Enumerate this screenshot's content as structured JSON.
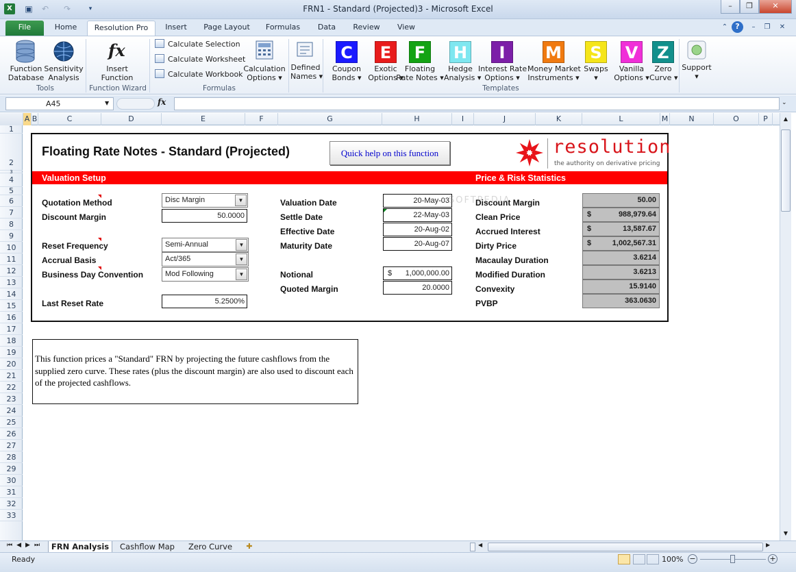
{
  "window": {
    "title": "FRN1 - Standard (Projected)3 - Microsoft Excel"
  },
  "tabs": [
    "File",
    "Home",
    "Resolution Pro",
    "Insert",
    "Page Layout",
    "Formulas",
    "Data",
    "Review",
    "View"
  ],
  "ribbon": {
    "tools": {
      "function_database": [
        "Function",
        "Database"
      ],
      "sensitivity_analysis": [
        "Sensitivity",
        "Analysis"
      ],
      "group": "Tools"
    },
    "wizard": {
      "insert_function": [
        "Insert",
        "Function"
      ],
      "group": "Function Wizard"
    },
    "formulas": {
      "calc_selection": "Calculate Selection",
      "calc_worksheet": "Calculate Worksheet",
      "calc_workbook": "Calculate Workbook",
      "calc_options": [
        "Calculation",
        "Options ▾"
      ],
      "defined_names": [
        "Defined",
        "Names ▾"
      ],
      "group": "Formulas"
    },
    "templates": {
      "group": "Templates",
      "items": [
        {
          "letter": "C",
          "color": "#1a1aff",
          "l1": "Coupon",
          "l2": "Bonds ▾"
        },
        {
          "letter": "E",
          "color": "#e81c1c",
          "l1": "Exotic",
          "l2": "Options ▾"
        },
        {
          "letter": "F",
          "color": "#13a313",
          "l1": "Floating",
          "l2": "Rate Notes ▾"
        },
        {
          "letter": "H",
          "color": "#7fe7f0",
          "l1": "Hedge",
          "l2": "Analysis ▾"
        },
        {
          "letter": "I",
          "color": "#7c1fa8",
          "l1": "Interest Rate",
          "l2": "Options ▾"
        },
        {
          "letter": "M",
          "color": "#f07a10",
          "l1": "Money Market",
          "l2": "Instruments ▾"
        },
        {
          "letter": "S",
          "color": "#f5e51a",
          "l1": "Swaps",
          "l2": "▾"
        },
        {
          "letter": "V",
          "color": "#f02fd8",
          "l1": "Vanilla",
          "l2": "Options ▾"
        },
        {
          "letter": "Z",
          "color": "#12908c",
          "l1": "Zero",
          "l2": "Curve ▾"
        }
      ]
    },
    "support": [
      "Support",
      "▾"
    ]
  },
  "formula_bar": {
    "name_box": "A45",
    "fx": "fx",
    "value": ""
  },
  "columns": [
    "A",
    "B",
    "C",
    "D",
    "E",
    "F",
    "G",
    "H",
    "I",
    "J",
    "K",
    "L",
    "M",
    "N",
    "O",
    "P"
  ],
  "rows": [
    "1",
    "2",
    "3",
    "4",
    "5",
    "6",
    "7",
    "8",
    "9",
    "10",
    "11",
    "12",
    "13",
    "14",
    "15",
    "16",
    "17",
    "18",
    "19",
    "20",
    "21",
    "22",
    "23",
    "24",
    "25",
    "26",
    "27",
    "28",
    "29",
    "30",
    "31",
    "32",
    "33"
  ],
  "sheet": {
    "title": "Floating Rate Notes - Standard (Projected)",
    "help_button": "Quick help on this function",
    "logo": {
      "word": "resolution",
      "tagline": "the authority on derivative pricing"
    },
    "valuation_header": "Valuation Setup",
    "stats_header": "Price & Risk Statistics",
    "setup": {
      "quotation_method": {
        "label": "Quotation Method",
        "value": "Disc Margin"
      },
      "discount_margin": {
        "label": "Discount Margin",
        "value": "50.0000"
      },
      "reset_frequency": {
        "label": "Reset Frequency",
        "value": "Semi-Annual"
      },
      "accrual_basis": {
        "label": "Accrual Basis",
        "value": "Act/365"
      },
      "business_day": {
        "label": "Business Day Convention",
        "value": "Mod Following"
      },
      "last_reset_rate": {
        "label": "Last Reset Rate",
        "value": "5.2500%"
      }
    },
    "dates": {
      "valuation_date": {
        "label": "Valuation Date",
        "value": "20-May-03"
      },
      "settle_date": {
        "label": "Settle Date",
        "value": "22-May-03"
      },
      "effective_date": {
        "label": "Effective Date",
        "value": "20-Aug-02"
      },
      "maturity_date": {
        "label": "Maturity Date",
        "value": "20-Aug-07"
      },
      "notional": {
        "label": "Notional",
        "currency": "$",
        "value": "1,000,000.00"
      },
      "quoted_margin": {
        "label": "Quoted Margin",
        "value": "20.0000"
      }
    },
    "stats": [
      {
        "label": "Discount Margin",
        "currency": "",
        "value": "50.00"
      },
      {
        "label": "Clean Price",
        "currency": "$",
        "value": "988,979.64"
      },
      {
        "label": "Accrued Interest",
        "currency": "$",
        "value": "13,587.67"
      },
      {
        "label": "Dirty Price",
        "currency": "$",
        "value": "1,002,567.31"
      },
      {
        "label": "Macaulay Duration",
        "currency": "",
        "value": "3.6214"
      },
      {
        "label": "Modified Duration",
        "currency": "",
        "value": "3.6213"
      },
      {
        "label": "Convexity",
        "currency": "",
        "value": "15.9140"
      },
      {
        "label": "PVBP",
        "currency": "",
        "value": "363.0630"
      }
    ],
    "description": "This function prices a \"Standard\" FRN by projecting  the future cashflows from the supplied zero curve. These rates (plus the discount margin) are also used to discount each of the projected  cashflows."
  },
  "sheet_tabs": [
    "FRN Analysis",
    "Cashflow Map",
    "Zero Curve"
  ],
  "status": {
    "ready": "Ready",
    "zoom": "100%"
  },
  "colors": {
    "red_header": "#ff0000",
    "stat_fill": "#c0c0c0",
    "help_text": "#0000cc",
    "excel_green": "#217a3a"
  }
}
